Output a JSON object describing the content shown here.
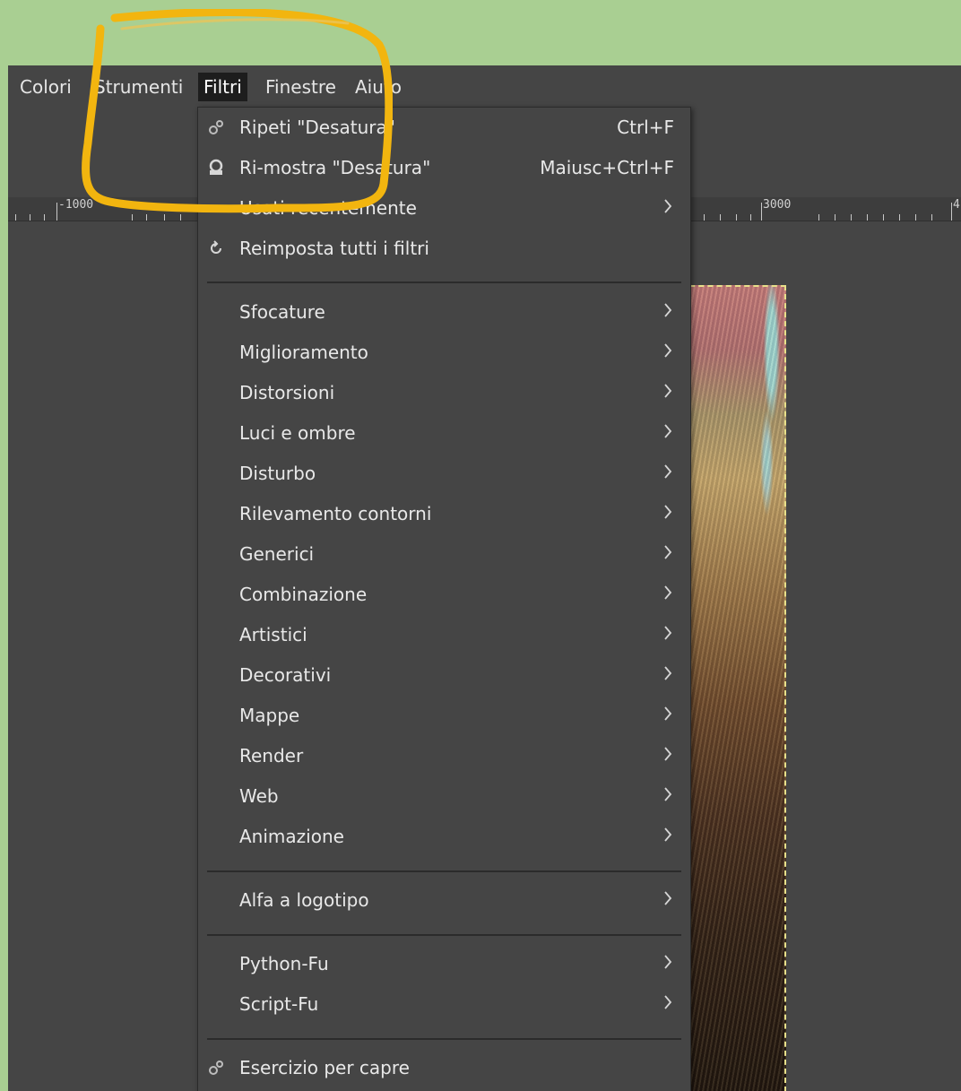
{
  "menubar": {
    "items": [
      "Colori",
      "Strumenti",
      "Filtri",
      "Finestre",
      "Aiuto"
    ],
    "active": "Filtri"
  },
  "ruler": {
    "labels": [
      "-1000",
      "3000",
      "4"
    ]
  },
  "filters_menu": {
    "top_items": [
      {
        "label": "Ripeti \"Desatura\"",
        "shortcut": "Ctrl+F",
        "icon": "gear-icon"
      },
      {
        "label": "Ri-mostra \"Desatura\"",
        "shortcut": "Maiusc+Ctrl+F",
        "icon": "gear-dialog-icon"
      },
      {
        "label": "Usati recentemente",
        "submenu": true
      },
      {
        "label": "Reimposta tutti i filtri",
        "icon": "reset-icon"
      }
    ],
    "categories": [
      "Sfocature",
      "Miglioramento",
      "Distorsioni",
      "Luci e ombre",
      "Disturbo",
      "Rilevamento contorni",
      "Generici",
      "Combinazione",
      "Artistici",
      "Decorativi",
      "Mappe",
      "Render",
      "Web",
      "Animazione"
    ],
    "logo_group": [
      "Alfa a logotipo"
    ],
    "scripts": [
      "Python-Fu",
      "Script-Fu"
    ],
    "bottom_item": {
      "label": "Esercizio per capre",
      "icon": "gear-icon"
    }
  },
  "colors": {
    "background": "#a9cf92",
    "app": "#454545",
    "active_menu": "#1d1d1d",
    "highlight_marker": "#f2b50f"
  }
}
